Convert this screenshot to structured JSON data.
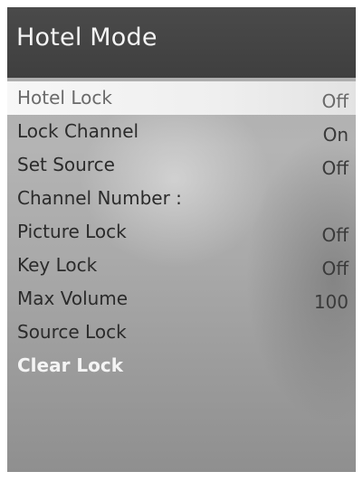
{
  "header": {
    "title": "Hotel Mode"
  },
  "menu": {
    "items": [
      {
        "label": "Hotel Lock",
        "value": "Off"
      },
      {
        "label": "Lock Channel",
        "value": "On"
      },
      {
        "label": "Set Source",
        "value": "Off"
      },
      {
        "label": "Channel Number :",
        "value": ""
      },
      {
        "label": "Picture Lock",
        "value": "Off"
      },
      {
        "label": "Key Lock",
        "value": "Off"
      },
      {
        "label": "Max Volume",
        "value": "100"
      },
      {
        "label": "Source Lock",
        "value": ""
      },
      {
        "label": "Clear Lock",
        "value": ""
      }
    ],
    "selected_item": "Hotel Lock"
  },
  "colors": {
    "title_bar": "#444444",
    "highlight": "#f4f4f4",
    "background": "#a8a8a8"
  }
}
